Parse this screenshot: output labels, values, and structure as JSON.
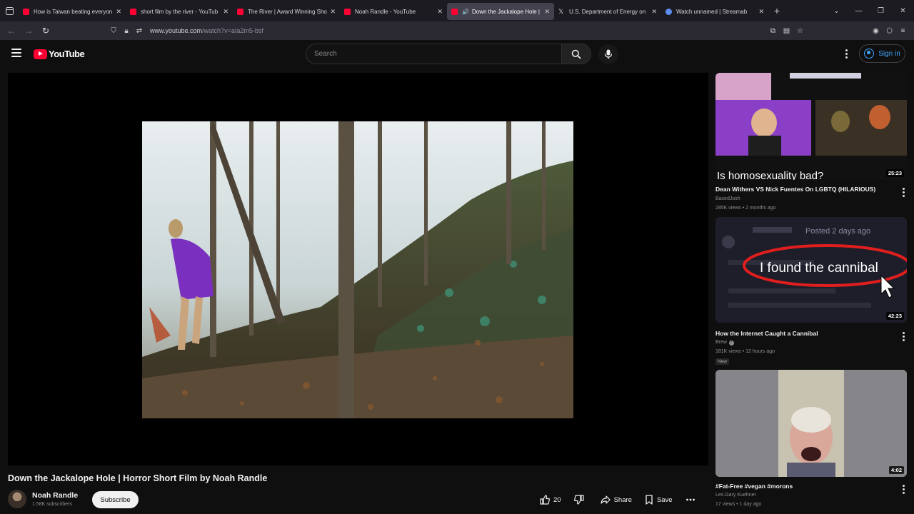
{
  "browser": {
    "tabs": [
      {
        "title": "How is Taiwan beating everyon",
        "favicon": "youtube"
      },
      {
        "title": "short film by the river - YouTub",
        "favicon": "youtube"
      },
      {
        "title": "The River | Award Winning Sho",
        "favicon": "youtube"
      },
      {
        "title": "Noah Randle - YouTube",
        "favicon": "youtube"
      },
      {
        "title": "Down the Jackalope Hole |",
        "favicon": "youtube",
        "active": true
      },
      {
        "title": "U.S. Department of Energy on",
        "favicon": "x"
      },
      {
        "title": "Watch unnamed | Streamab",
        "favicon": "streamable"
      }
    ],
    "url_host": "www.youtube.com",
    "url_path": "/watch?v=aIa2m5-bsf"
  },
  "masthead": {
    "logo_text": "YouTube",
    "search_placeholder": "Search",
    "signin_label": "Sign in"
  },
  "video": {
    "title": "Down the Jackalope Hole | Horror Short Film by Noah Randle",
    "channel": "Noah Randle",
    "subscribers": "1.58K subscribers",
    "subscribe_label": "Subscribe",
    "likes": "20",
    "share_label": "Share",
    "save_label": "Save"
  },
  "recommendations": [
    {
      "thumb_text": "Is homosexuality bad?",
      "duration": "25:23",
      "title": "Dean Withers VS Nick Fuentes On LGBTQ (HILARIOUS)",
      "channel": "BasedJosh",
      "meta": "285K views • 2 months ago"
    },
    {
      "thumb_text": "I found the cannibal",
      "thumb_subtext": "Posted 2 days ago",
      "duration": "42:23",
      "title": "How the Internet Caught a Cannibal",
      "channel": "Brew",
      "meta": "181K views • 12 hours ago",
      "badge": "New"
    },
    {
      "duration": "4:02",
      "title": "#Fat-Free #vegan #morons",
      "channel": "Les.Gary Kuehner",
      "meta": "17 views • 1 day ago"
    }
  ],
  "colors": {
    "brand_red": "#ff0033",
    "link_blue": "#3ea6ff",
    "background": "#0f0f0f"
  }
}
